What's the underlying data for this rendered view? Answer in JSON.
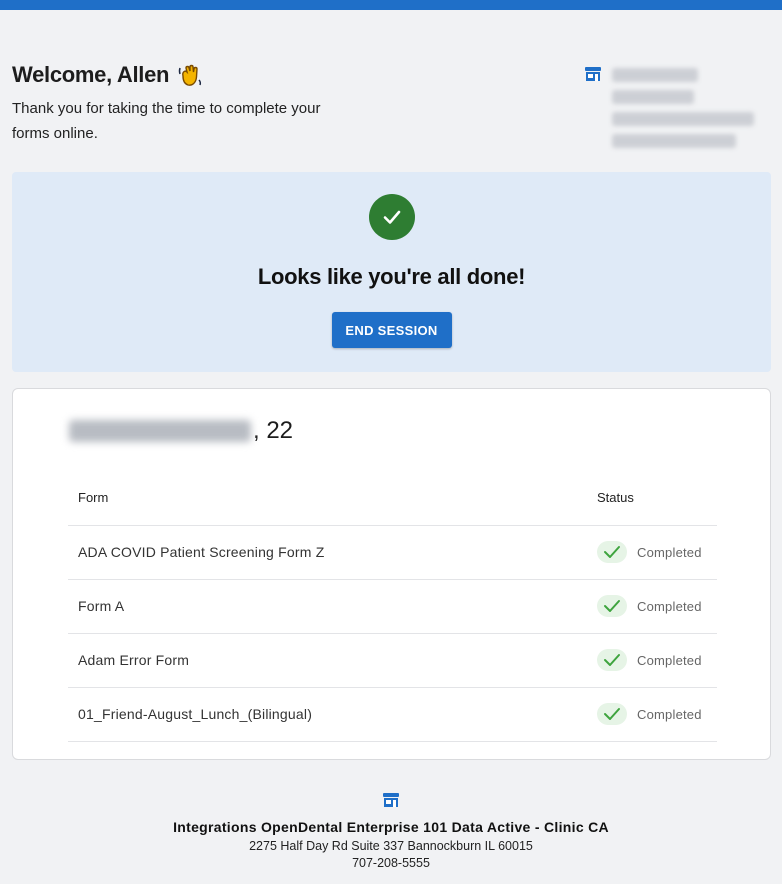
{
  "colors": {
    "accent": "#1f6fc8",
    "success": "#2e7d32",
    "panel": "#dfeaf7"
  },
  "header": {
    "title": "Welcome, Allen",
    "subtitle": "Thank you for taking the time to complete your forms online.",
    "clinic_icon": "store-icon"
  },
  "done": {
    "icon": "check-icon",
    "title": "Looks like you're all done!",
    "button": "END SESSION"
  },
  "patient": {
    "age": ", 22"
  },
  "table": {
    "headers": {
      "form": "Form",
      "status": "Status"
    },
    "rows": [
      {
        "form": "ADA COVID Patient Screening Form Z",
        "status": "Completed"
      },
      {
        "form": "Form A",
        "status": "Completed"
      },
      {
        "form": "Adam Error Form",
        "status": "Completed"
      },
      {
        "form": "01_Friend-August_Lunch_(Bilingual)",
        "status": "Completed"
      }
    ]
  },
  "footer": {
    "icon": "store-icon",
    "clinic_name": "Integrations OpenDental Enterprise 101 Data Active - Clinic CA",
    "address": "2275 Half Day Rd Suite 337 Bannockburn IL 60015",
    "phone": "707-208-5555"
  }
}
